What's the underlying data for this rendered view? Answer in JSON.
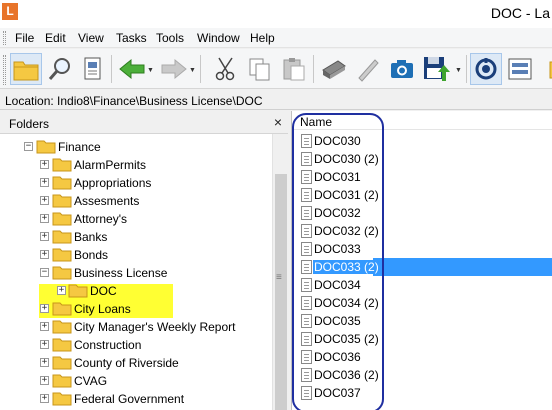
{
  "window": {
    "app_icon_letter": "L",
    "title": "DOC - La"
  },
  "menu": [
    "File",
    "Edit",
    "View",
    "Tasks",
    "Tools",
    "Window",
    "Help"
  ],
  "toolbar": {
    "buttons": [
      "open-folder",
      "search",
      "properties",
      "back",
      "forward",
      "cut",
      "copy",
      "paste",
      "scan",
      "annotate",
      "camera",
      "import",
      "refresh",
      "sync",
      "more"
    ]
  },
  "location": {
    "label": "Location:",
    "path": "Indio8\\Finance\\Business License\\DOC",
    "full": "Location:  Indio8\\Finance\\Business License\\DOC"
  },
  "folders": {
    "title": "Folders",
    "close": "×",
    "items": [
      {
        "label": "Finance",
        "level": 0,
        "expanded": true
      },
      {
        "label": "AlarmPermits",
        "level": 1
      },
      {
        "label": "Appropriations",
        "level": 1
      },
      {
        "label": "Assesments",
        "level": 1
      },
      {
        "label": "Attorney's",
        "level": 1
      },
      {
        "label": "Banks",
        "level": 1
      },
      {
        "label": "Bonds",
        "level": 1
      },
      {
        "label": "Business License",
        "level": 1,
        "expanded": true,
        "highlighted": true
      },
      {
        "label": "DOC",
        "level": 2,
        "highlighted": true
      },
      {
        "label": "City Loans",
        "level": 1
      },
      {
        "label": "City Manager's Weekly Report",
        "level": 1
      },
      {
        "label": "Construction",
        "level": 1
      },
      {
        "label": "County of Riverside",
        "level": 1
      },
      {
        "label": "CVAG",
        "level": 1
      },
      {
        "label": "Federal Government",
        "level": 1
      }
    ]
  },
  "files": {
    "column_name": "Name",
    "items": [
      "DOC030",
      "DOC030 (2)",
      "DOC031",
      "DOC031 (2)",
      "DOC032",
      "DOC032 (2)",
      "DOC033",
      "DOC033 (2)",
      "DOC034",
      "DOC034 (2)",
      "DOC035",
      "DOC035 (2)",
      "DOC036",
      "DOC036 (2)",
      "DOC037"
    ],
    "selected_index": 7
  },
  "colors": {
    "selection": "#3399ff",
    "highlight": "#ffff33",
    "annotation": "#1f2fa0",
    "folder": "#f5c842"
  }
}
